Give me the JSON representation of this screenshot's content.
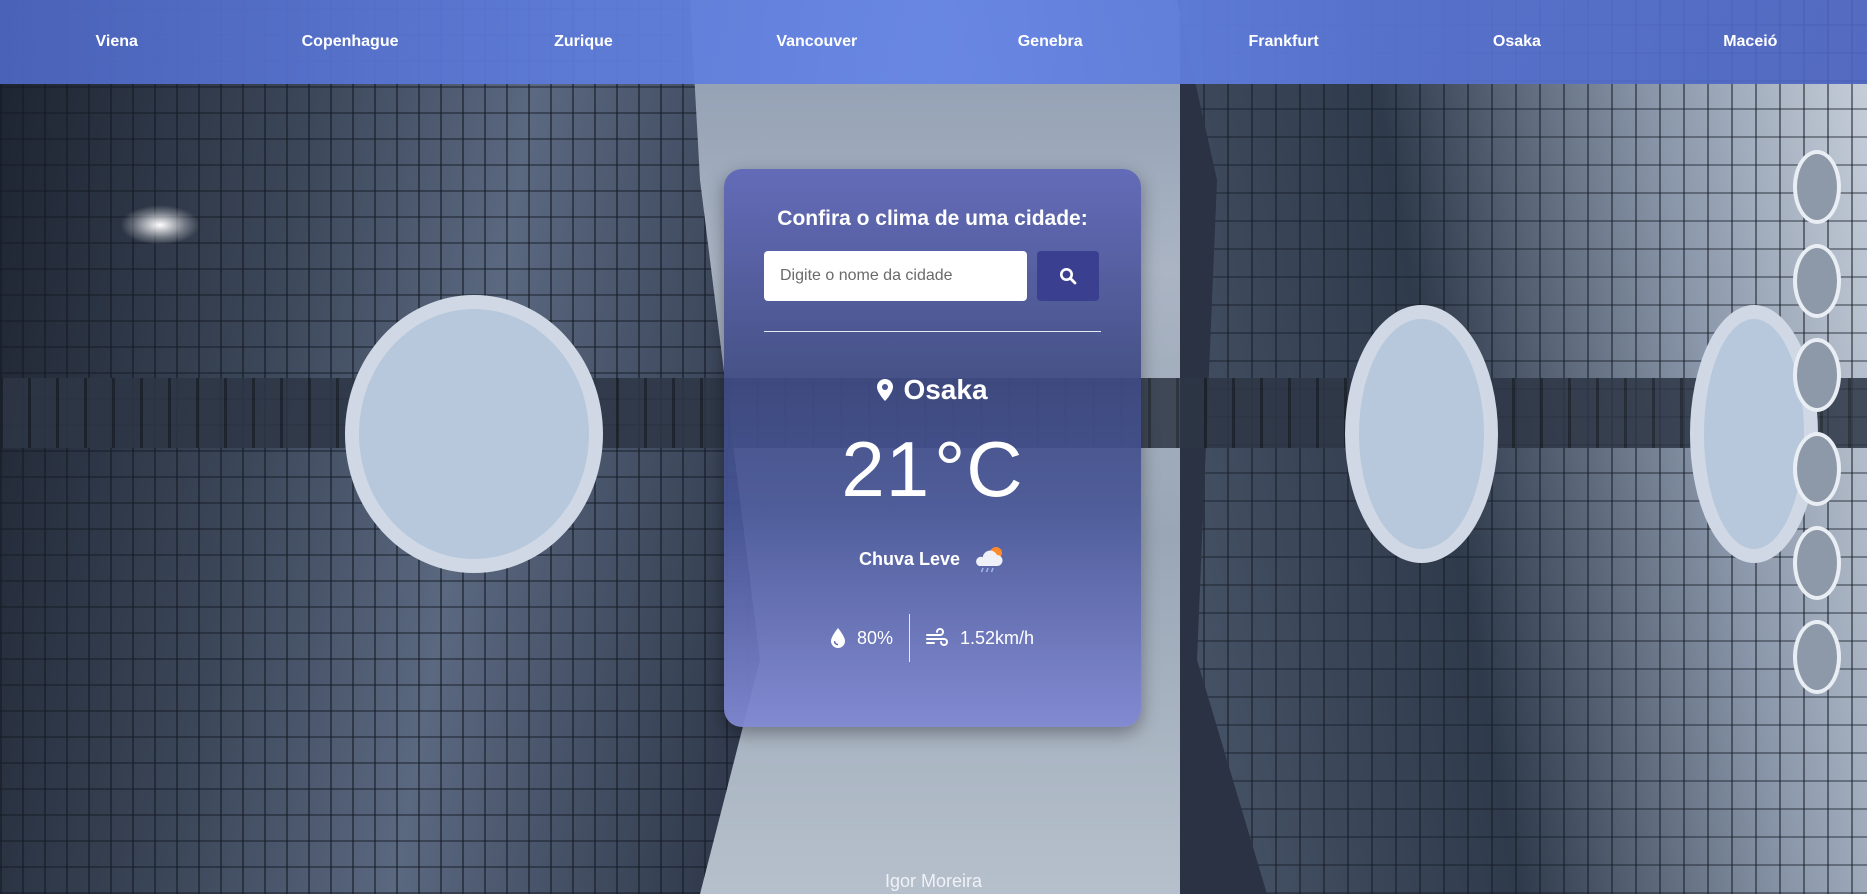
{
  "nav": {
    "cities": [
      "Viena",
      "Copenhague",
      "Zurique",
      "Vancouver",
      "Genebra",
      "Frankfurt",
      "Osaka",
      "Maceió"
    ]
  },
  "card": {
    "title": "Confira o clima de uma cidade:",
    "search": {
      "placeholder": "Digite o nome da cidade",
      "value": "",
      "button_icon": "search-icon"
    },
    "city_icon": "map-pin-icon",
    "city": "Osaka",
    "temperature": "21",
    "unit": "°C",
    "description": "Chuva Leve",
    "weather_icon": "light-rain-cloud-icon",
    "humidity": {
      "icon": "droplet-icon",
      "value": "80%"
    },
    "wind": {
      "icon": "wind-icon",
      "value": "1.52km/h"
    }
  },
  "footer": {
    "author": "Igor Moreira"
  },
  "colors": {
    "nav_bg": "#6686e6",
    "card_bg": "#5a62b0",
    "search_button": "#3a3f8f",
    "text": "#ffffff"
  }
}
